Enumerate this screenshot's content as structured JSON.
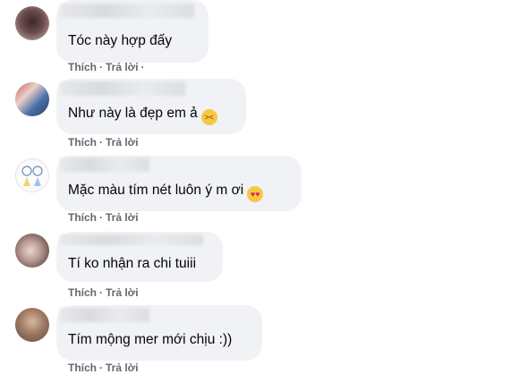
{
  "comments": [
    {
      "text": "Tóc này hợp đấy",
      "emoji": "",
      "like": "Thích",
      "reply": "Trả lời"
    },
    {
      "text": "Như này là đẹp em ả",
      "emoji": "squinting-tongue-emoji",
      "like": "Thích",
      "reply": "Trả lời"
    },
    {
      "text": "Mặc màu tím nét luôn ý m ơi",
      "emoji": "heart-eyes-emoji",
      "like": "Thích",
      "reply": "Trả lời"
    },
    {
      "text": "Tí ko nhận ra chi tuiii",
      "emoji": "",
      "like": "Thích",
      "reply": "Trả lời"
    },
    {
      "text": "Tím mộng mer mới chịu :))",
      "emoji": "",
      "like": "Thích",
      "reply": "Trả lời"
    }
  ],
  "separator": "·",
  "colors": {
    "bubble": "#f0f2f5",
    "action_text": "#65676b",
    "comment_text": "#050505"
  }
}
